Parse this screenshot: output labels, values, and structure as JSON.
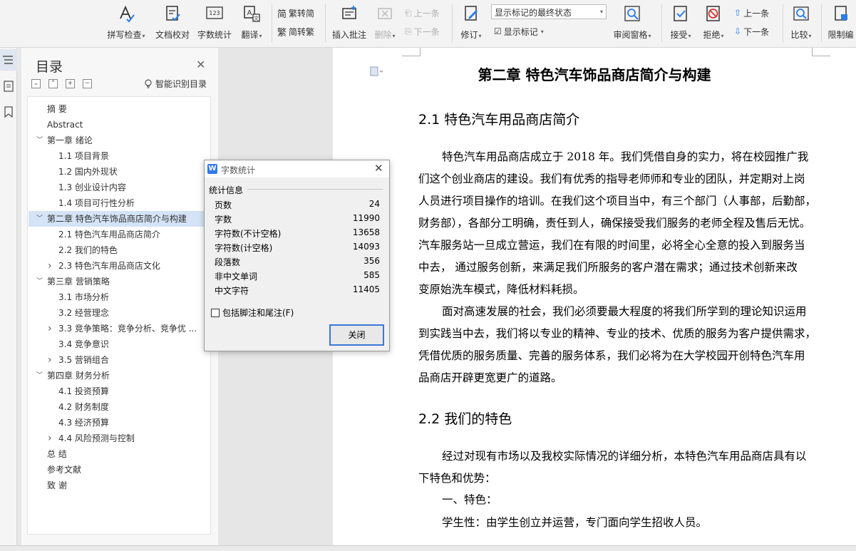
{
  "toolbar": {
    "spell_check": "拼写检查",
    "doc_proof": "文档校对",
    "word_count": "字数统计",
    "translate": "翻译",
    "trad_to_simp": "繁转简",
    "simp_to_trad": "简转繁",
    "insert_comment": "插入批注",
    "delete": "删除",
    "prev_comment": "上一条",
    "next_comment": "下一条",
    "track_changes": "修订",
    "markup_state": "显示标记的最终状态",
    "show_markup": "显示标记",
    "review_pane": "审阅窗格",
    "accept": "接受",
    "reject": "拒绝",
    "prev_change": "上一条",
    "next_change": "下一条",
    "compare": "比较",
    "restrict_edit": "限制编"
  },
  "toc": {
    "title": "目录",
    "smart_toc": "智能识别目录",
    "items": [
      {
        "label": "摘    要",
        "level": 1,
        "arrow": ""
      },
      {
        "label": "Abstract",
        "level": 1,
        "arrow": ""
      },
      {
        "label": "第一章  绪论",
        "level": 1,
        "arrow": "down"
      },
      {
        "label": "1.1 项目背景",
        "level": 2,
        "arrow": ""
      },
      {
        "label": "1.2 国内外现状",
        "level": 2,
        "arrow": ""
      },
      {
        "label": "1.3 创业设计内容",
        "level": 2,
        "arrow": ""
      },
      {
        "label": "1.4 项目可行性分析",
        "level": 2,
        "arrow": ""
      },
      {
        "label": "第二章  特色汽车饰品商店简介与构建",
        "level": 1,
        "arrow": "down",
        "selected": true
      },
      {
        "label": "2.1 特色汽车用品商店简介",
        "level": 2,
        "arrow": ""
      },
      {
        "label": "2.2 我们的特色",
        "level": 2,
        "arrow": ""
      },
      {
        "label": "2.3 特色汽车用品商店文化",
        "level": 2,
        "arrow": "right"
      },
      {
        "label": "第三章  营销策略",
        "level": 1,
        "arrow": "down"
      },
      {
        "label": "3.1 市场分析",
        "level": 2,
        "arrow": ""
      },
      {
        "label": "3.2 经营理念",
        "level": 2,
        "arrow": ""
      },
      {
        "label": "3.3 竞争策略：竞争分析、竞争优 ...",
        "level": 2,
        "arrow": "right"
      },
      {
        "label": "3.4 竞争意识",
        "level": 2,
        "arrow": ""
      },
      {
        "label": "3.5 营销组合",
        "level": 2,
        "arrow": "right"
      },
      {
        "label": "第四章  财务分析",
        "level": 1,
        "arrow": "down"
      },
      {
        "label": "4.1 投资预算",
        "level": 2,
        "arrow": ""
      },
      {
        "label": "4.2 财务制度",
        "level": 2,
        "arrow": ""
      },
      {
        "label": "4.3 经济预算",
        "level": 2,
        "arrow": ""
      },
      {
        "label": "4.4 风险预测与控制",
        "level": 2,
        "arrow": "right"
      },
      {
        "label": "总    结",
        "level": 1,
        "arrow": ""
      },
      {
        "label": "参考文献",
        "level": 1,
        "arrow": ""
      },
      {
        "label": "致    谢",
        "level": 1,
        "arrow": ""
      }
    ]
  },
  "dialog": {
    "title": "字数统计",
    "group": "统计信息",
    "stats": [
      {
        "label": "页数",
        "value": "24"
      },
      {
        "label": "字数",
        "value": "11990"
      },
      {
        "label": "字符数(不计空格)",
        "value": "13658"
      },
      {
        "label": "字符数(计空格)",
        "value": "14093"
      },
      {
        "label": "段落数",
        "value": "356"
      },
      {
        "label": "非中文单词",
        "value": "585"
      },
      {
        "label": "中文字符",
        "value": "11405"
      }
    ],
    "include_footnotes": "包括脚注和尾注(F)",
    "close_button": "关闭"
  },
  "document": {
    "chapter_title": "第二章  特色汽车饰品商店简介与构建",
    "section1": "2.1 特色汽车用品商店简介",
    "section1_lines": [
      "特色汽车用品商店成立于 2018 年。我们凭借自身的实力，将在校园推广我",
      "们这个创业商店的建设。我们有优秀的指导老师师和专业的团队，并定期对上岗",
      "人员进行项目操作的培训。在我们这个项目当中，有三个部门（人事部，后勤部，",
      "财务部），各部分工明确，责任到人，确保接受我们服务的老师全程及售后无忧。",
      "汽车服务站一旦成立营运，我们在有限的时间里，必将全心全意的投入到服务当",
      "中去，  通过服务创新，来满足我们所服务的客户潜在需求；通过技术创新来改",
      "变原始洗车模式，降低材料耗损。",
      "面对高速发展的社会，我们必须要最大程度的将我们所学到的理论知识运用",
      "到实践当中去，我们将以专业的精神、专业的技术、优质的服务为客户提供需求，",
      "凭借优质的服务质量、完善的服务体系，我们必将为在大学校园开创特色汽车用",
      "品商店开辟更宽更广的道路。"
    ],
    "section2": "2.2 我们的特色",
    "section2_lines": [
      "经过对现有市场以及我校实际情况的详细分析，本特色汽车用品商店具有以",
      "下特色和优势：",
      "一、特色：",
      "学生性：由学生创立并运营，专门面向学生招收人员。"
    ]
  }
}
